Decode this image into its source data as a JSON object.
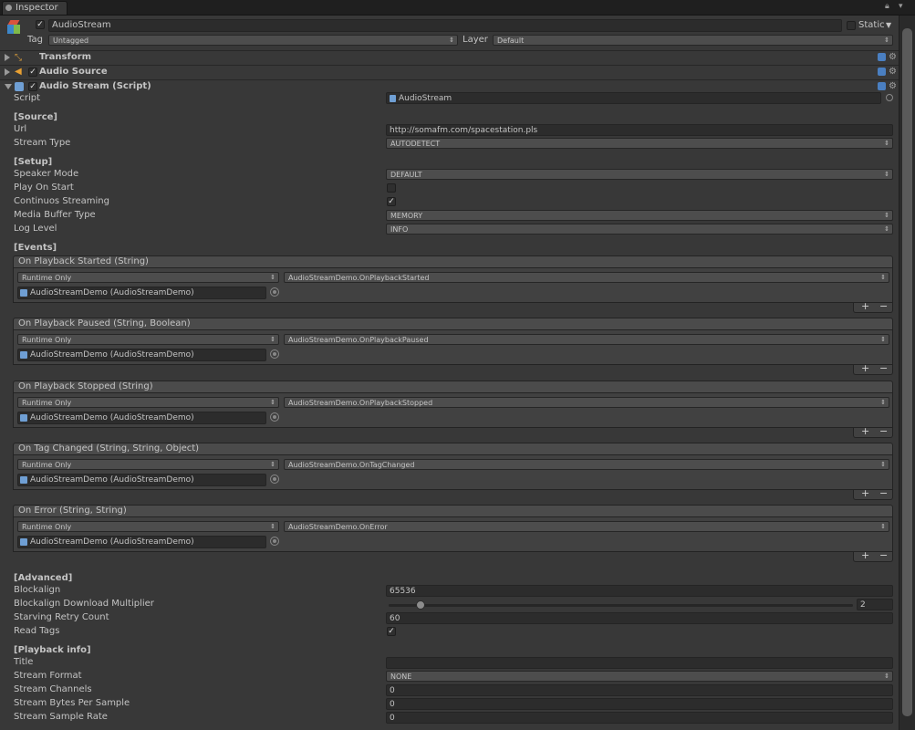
{
  "window": {
    "tab_title": "Inspector"
  },
  "gameobject": {
    "name": "AudioStream",
    "static_label": "Static",
    "tag_label": "Tag",
    "tag_value": "Untagged",
    "layer_label": "Layer",
    "layer_value": "Default"
  },
  "components": {
    "transform": "Transform",
    "audio_source": "Audio Source",
    "audio_stream": "Audio Stream (Script)"
  },
  "script": {
    "label": "Script",
    "value": "AudioStream"
  },
  "source": {
    "header": "[Source]",
    "url_label": "Url",
    "url_value": "http://somafm.com/spacestation.pls",
    "stream_type_label": "Stream Type",
    "stream_type_value": "AUTODETECT"
  },
  "setup": {
    "header": "[Setup]",
    "speaker_mode_label": "Speaker Mode",
    "speaker_mode_value": "DEFAULT",
    "play_on_start_label": "Play On Start",
    "play_on_start_checked": false,
    "continuous_label": "Continuos Streaming",
    "continuous_checked": true,
    "media_buffer_label": "Media Buffer Type",
    "media_buffer_value": "MEMORY",
    "log_level_label": "Log Level",
    "log_level_value": "INFO"
  },
  "events": {
    "header": "[Events]",
    "runtime": "Runtime Only",
    "object": "AudioStreamDemo (AudioStreamDemo)",
    "plus": "+",
    "minus": "−",
    "list": [
      {
        "title": "On Playback Started (String)",
        "function": "AudioStreamDemo.OnPlaybackStarted"
      },
      {
        "title": "On Playback Paused (String, Boolean)",
        "function": "AudioStreamDemo.OnPlaybackPaused"
      },
      {
        "title": "On Playback Stopped (String)",
        "function": "AudioStreamDemo.OnPlaybackStopped"
      },
      {
        "title": "On Tag Changed (String, String, Object)",
        "function": "AudioStreamDemo.OnTagChanged"
      },
      {
        "title": "On Error (String, String)",
        "function": "AudioStreamDemo.OnError"
      }
    ]
  },
  "advanced": {
    "header": "[Advanced]",
    "blockalign_label": "Blockalign",
    "blockalign_value": "65536",
    "multiplier_label": "Blockalign Download Multiplier",
    "multiplier_value": "2",
    "starving_label": "Starving Retry Count",
    "starving_value": "60",
    "read_tags_label": "Read Tags",
    "read_tags_checked": true
  },
  "playback_info": {
    "header": "[Playback info]",
    "title_label": "Title",
    "title_value": "",
    "format_label": "Stream Format",
    "format_value": "NONE",
    "channels_label": "Stream Channels",
    "channels_value": "0",
    "bytes_label": "Stream Bytes Per Sample",
    "bytes_value": "0",
    "rate_label": "Stream Sample Rate",
    "rate_value": "0"
  }
}
